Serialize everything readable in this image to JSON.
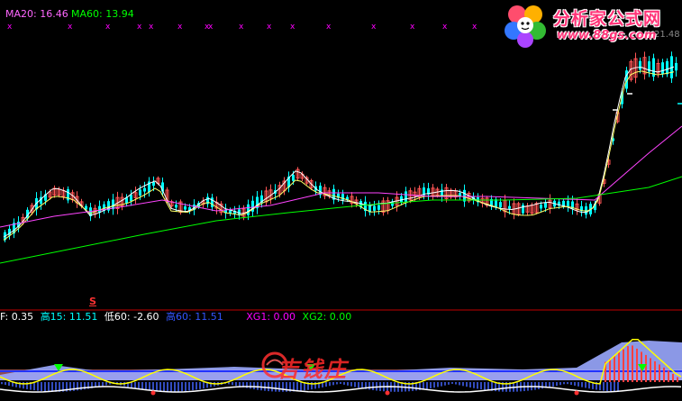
{
  "main_legend": {
    "ma20_label": "MA20:",
    "ma20_value": "16.46",
    "ma60_label": "MA60:",
    "ma60_value": "13.94",
    "colors": {
      "ma20": "#ff66ff",
      "ma60": "#00ff00"
    }
  },
  "price_marker": {
    "text": "21.48"
  },
  "signal_marker": {
    "text": "S"
  },
  "sub_legend": {
    "f_label": "F:",
    "f_value": "0.35",
    "high15_label": "高15:",
    "high15_value": "11.51",
    "low60_label": "低60:",
    "low60_value": "-2.60",
    "high60_label": "高60:",
    "high60_value": "11.51",
    "xg1_label": "XG1:",
    "xg1_value": "0.00",
    "xg2_label": "XG2:",
    "xg2_value": "0.00",
    "colors": {
      "f": "#ffffff",
      "high15": "#00ffff",
      "low60": "#ffffff",
      "high60": "#3355ff",
      "xg1": "#ff00ff",
      "xg2": "#00ff00"
    }
  },
  "watermark_top": {
    "logo_text": "分析家公式网",
    "url_text": "www.88gs.com"
  },
  "watermark_bottom": {
    "text": "吉钱庄"
  },
  "theme": {
    "background": "#000000",
    "up_color": "#ff5555",
    "down_color": "#00ffff",
    "divider_color": "#c00000"
  }
}
